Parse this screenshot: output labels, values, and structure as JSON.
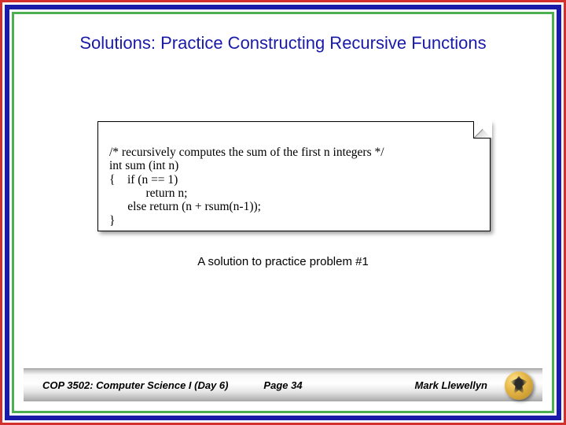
{
  "title": "Solutions: Practice Constructing Recursive Functions",
  "code": "/* recursively computes the sum of the first n integers */\nint sum (int n)\n{    if (n == 1)\n            return n;\n      else return (n + rsum(n-1));\n}",
  "caption": "A solution to practice problem #1",
  "footer": {
    "left": "COP 3502: Computer Science I  (Day 6)",
    "center": "Page 34",
    "right": "Mark Llewellyn"
  }
}
